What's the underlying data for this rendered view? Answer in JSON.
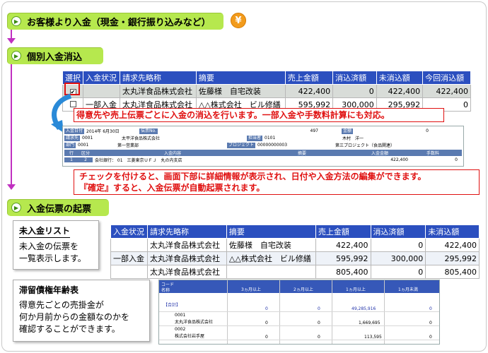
{
  "step1": {
    "label": "お客様より入金（現金・銀行振り込みなど）",
    "yen": "¥"
  },
  "step2": {
    "label": "個別入金消込"
  },
  "step3": {
    "label": "入金伝票の起票"
  },
  "kesikomi": {
    "headers": [
      "選択",
      "入金状況",
      "請求先略称",
      "摘要",
      "売上金額",
      "消込済額",
      "未消込額",
      "今回消込額"
    ],
    "rows": [
      {
        "checked": "✔",
        "status": "",
        "client": "太丸洋食品株式会社",
        "memo": "佐藤様　自宅改装",
        "sales": "422,400",
        "done": "0",
        "remaining": "422,400",
        "current": "422,400"
      },
      {
        "checked": "",
        "status": "一部入金",
        "client": "太丸洋食品株式会社",
        "memo": "△△株式会社　ビル修繕",
        "sales": "595,992",
        "done": "300,000",
        "remaining": "295,992",
        "current": "0"
      }
    ]
  },
  "note1": "得意先や売上伝票ごとに入金の消込を行います。一部入金や手数料計算にも対応。",
  "detail": {
    "date_label": "入金日付",
    "date_value": "2014年 6月30日",
    "slip_label": "伝票No.",
    "slip_value": "497",
    "kingaku_label": "金額",
    "kingaku_value": "0",
    "seikyu_label": "請求先",
    "seikyu_code": "0001",
    "seikyu_name": "太平洋食品株式会社",
    "tanto_label": "担当者",
    "tanto_code": "0101",
    "tanto_name": "木村　洋一",
    "bumon_label": "部門",
    "bumon_code": "0001",
    "bumon_name": "第一営業部",
    "proj_label": "プロジェクト",
    "proj_code": "00000000003",
    "proj_name": "第三プロジェクト（食品関連）",
    "grid_headers": [
      "行",
      "区分",
      "入金内容",
      "摘要",
      "入金金額",
      "手数料"
    ],
    "grid_row": [
      "1",
      "2",
      "会社銀行： 01　三菱東京ＵＦＪ　丸の内支店",
      "",
      "422,400",
      "0"
    ]
  },
  "note2_line1": "チェックを付けると、画面下部に詳細情報が表示され、日付や入金方法の編集ができます。",
  "note2_line2": "『確定』すると、入金伝票が自動起票されます。",
  "unpaid": {
    "title": "未入金リスト",
    "desc_line1": "未入金の伝票を",
    "desc_line2": "一覧表示します。",
    "headers": [
      "入金状況",
      "請求先略称",
      "摘要",
      "売上金額",
      "消込済額",
      "未消込額"
    ],
    "rows": [
      [
        "",
        "太丸洋食品株式会社",
        "佐藤様　自宅改装",
        "422,400",
        "0",
        "422,400"
      ],
      [
        "一部入金",
        "太丸洋食品株式会社",
        "△△株式会社　ビル修繕",
        "595,992",
        "300,000",
        "295,992"
      ],
      [
        "",
        "太丸洋食品株式会社",
        "",
        "805,400",
        "0",
        "805,400"
      ]
    ]
  },
  "aging_info": {
    "title": "滞留債権年齢表",
    "desc_line1": "得意先ごとの売掛金が",
    "desc_line2": "何か月前からの金額なのかを",
    "desc_line3": "確認することができます。"
  },
  "aging": {
    "hdr_code": "コード",
    "hdr_name": "名称",
    "cols": [
      "3ヵ月以上",
      "2ヵ月以上",
      "1ヵ月以上",
      "1ヵ月未満"
    ],
    "total_label": "【合計】",
    "total_values": [
      "0",
      "0",
      "49,285,916",
      "0"
    ],
    "rows": [
      {
        "code": "0001",
        "name": "太丸洋食品株式会社",
        "values": [
          "0",
          "0",
          "1,669,695",
          "0"
        ]
      },
      {
        "code": "0002",
        "name": "株式会社岩手屋",
        "values": [
          "0",
          "0",
          "113,595",
          "0"
        ]
      }
    ]
  },
  "colors": {
    "pill": "#b6e84e",
    "header_blue": "#2b4fbf",
    "accent_red": "#e01010",
    "connector": "#c030c0"
  }
}
